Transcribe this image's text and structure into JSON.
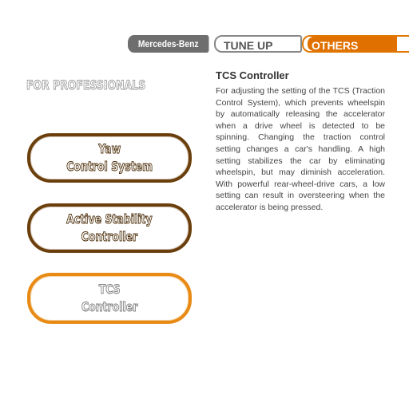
{
  "tabs": {
    "brand": "Mercedes-Benz",
    "tune_up": "TUNE UP",
    "others": "OTHERS"
  },
  "section": {
    "heading": "FOR PROFESSIONALS"
  },
  "menu": {
    "items": [
      {
        "label": "Yaw\nControl System",
        "state": "normal"
      },
      {
        "label": "Active Stability\nController",
        "state": "normal"
      },
      {
        "label": "TCS\nController",
        "state": "selected"
      }
    ]
  },
  "description": {
    "title": "TCS Controller",
    "body": "For adjusting the setting of the TCS (Traction Control System), which prevents wheelspin by automatically releasing the accelerator when a drive wheel is detected to be spinning. Changing the traction control setting changes a car's handling. A high setting stabilizes the car by eliminating wheelspin, but may diminish acceleration. With powerful rear-wheel-drive cars, a low setting can result in oversteering when the accelerator is being pressed."
  },
  "colors": {
    "accent": "#e07000",
    "button_border": "#6b3f0c",
    "selected_border": "#e88a14",
    "brand_tab": "#6e6e6e"
  }
}
